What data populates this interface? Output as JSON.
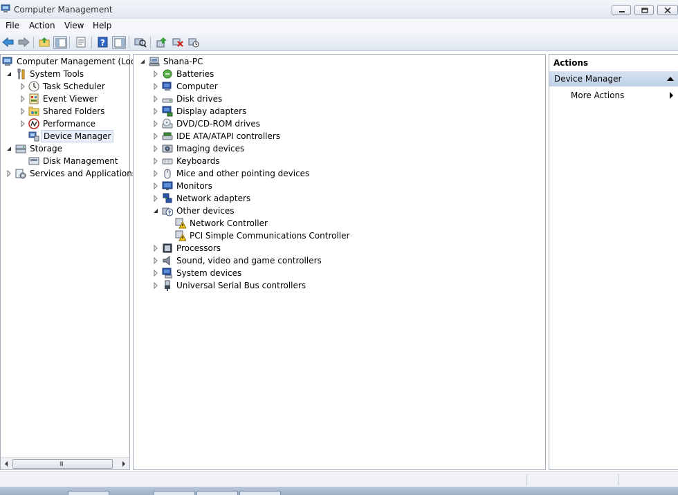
{
  "window": {
    "title": "Computer Management"
  },
  "menu": [
    "File",
    "Action",
    "View",
    "Help"
  ],
  "toolbar": {
    "icons": [
      "back-arrow-icon",
      "forward-arrow-icon",
      "up-folder-icon",
      "show-hide-tree-icon",
      "properties-icon",
      "help-icon",
      "show-hide-action-pane-icon",
      "scan-hardware-icon",
      "update-driver-icon",
      "uninstall-device-icon",
      "disable-device-icon"
    ]
  },
  "tree": {
    "root": "Computer Management (Local",
    "system_tools": "System Tools",
    "task_scheduler": "Task Scheduler",
    "event_viewer": "Event Viewer",
    "shared_folders": "Shared Folders",
    "performance": "Performance",
    "device_manager": "Device Manager",
    "storage": "Storage",
    "disk_management": "Disk Management",
    "services_apps": "Services and Applications"
  },
  "devices": {
    "computer_name": "Shana-PC",
    "categories": [
      "Batteries",
      "Computer",
      "Disk drives",
      "Display adapters",
      "DVD/CD-ROM drives",
      "IDE ATA/ATAPI controllers",
      "Imaging devices",
      "Keyboards",
      "Mice and other pointing devices",
      "Monitors",
      "Network adapters",
      "Other devices",
      "Processors",
      "Sound, video and game controllers",
      "System devices",
      "Universal Serial Bus controllers"
    ],
    "other_devices_children": [
      "Network Controller",
      "PCI Simple Communications Controller"
    ]
  },
  "actions": {
    "header": "Actions",
    "section": "Device Manager",
    "more_actions": "More Actions"
  },
  "scrollbar": {
    "grip": "III"
  }
}
